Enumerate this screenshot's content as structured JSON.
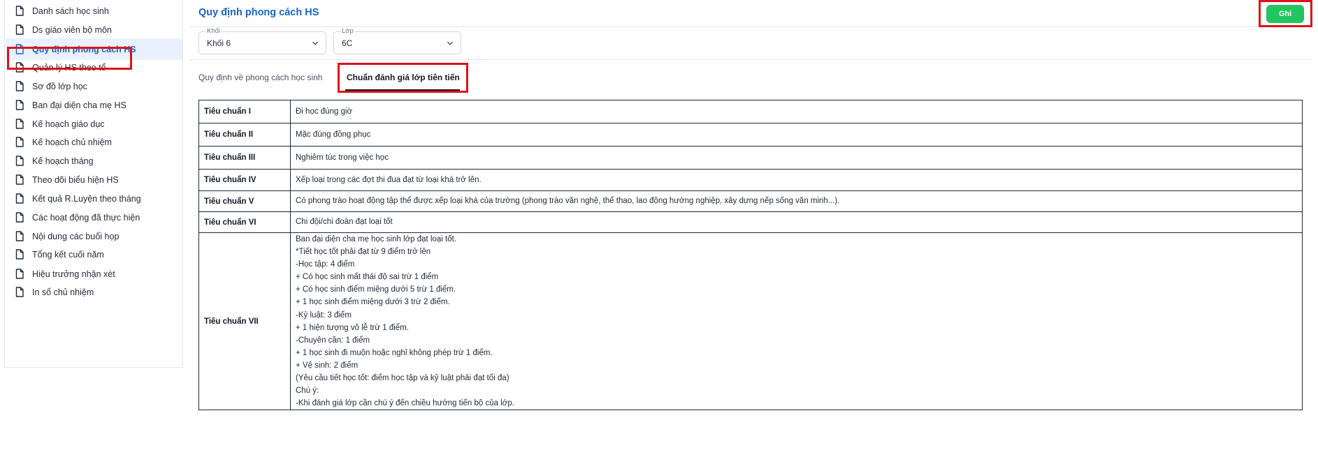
{
  "sidebar": {
    "items": [
      {
        "label": "Danh sách học sinh",
        "active": false
      },
      {
        "label": "Ds giáo viên bộ môn",
        "active": false
      },
      {
        "label": "Quy định phong cách HS",
        "active": true
      },
      {
        "label": "Quản lý HS theo tổ",
        "active": false
      },
      {
        "label": "Sơ đồ lớp học",
        "active": false
      },
      {
        "label": "Ban đại diện cha mẹ HS",
        "active": false
      },
      {
        "label": "Kế hoạch giáo dục",
        "active": false
      },
      {
        "label": "Kế hoạch chủ nhiệm",
        "active": false
      },
      {
        "label": "Kế hoạch tháng",
        "active": false
      },
      {
        "label": "Theo dõi biểu hiện HS",
        "active": false
      },
      {
        "label": "Kết quả R.Luyện theo tháng",
        "active": false
      },
      {
        "label": "Các hoạt động đã thực hiện",
        "active": false
      },
      {
        "label": "Nội dung các buổi họp",
        "active": false
      },
      {
        "label": "Tổng kết cuối năm",
        "active": false
      },
      {
        "label": "Hiệu trưởng nhận xét",
        "active": false
      },
      {
        "label": "In sổ chủ nhiệm",
        "active": false
      }
    ]
  },
  "header": {
    "title": "Quy định phong cách HS",
    "save_label": "Ghi"
  },
  "filters": {
    "grade": {
      "legend": "Khối",
      "value": "Khối 6"
    },
    "class": {
      "legend": "Lớp",
      "value": "6C"
    }
  },
  "tabs": [
    {
      "label": "Quy định về phong cách học sinh",
      "active": false
    },
    {
      "label": "Chuẩn đánh giá lớp tiên tiến",
      "active": true
    }
  ],
  "criteria": [
    {
      "name": "Tiêu chuẩn I",
      "lines": [
        "Đi học đúng giờ"
      ]
    },
    {
      "name": "Tiêu chuẩn II",
      "lines": [
        "Mặc đúng đồng phục"
      ]
    },
    {
      "name": "Tiêu chuẩn III",
      "lines": [
        "Nghiêm túc trong việc học"
      ]
    },
    {
      "name": "Tiêu chuẩn IV",
      "lines": [
        "Xếp loại trong các đợt thi đua đạt từ loại khá trở lên."
      ]
    },
    {
      "name": "Tiêu chuẩn V",
      "lines": [
        "Có phong trào hoạt động tập thể được xếp loại khá của trường (phong trào văn nghệ, thể thao, lao động hướng nghiệp, xây dựng nếp sống văn minh...)."
      ]
    },
    {
      "name": "Tiêu chuẩn VI",
      "lines": [
        "Chi đội/chi đoàn đạt loại tốt"
      ]
    },
    {
      "name": "Tiêu chuẩn VII",
      "lines": [
        "Ban đại diện cha mẹ học sinh lớp đạt loại tốt.",
        "*Tiết học tốt phải đạt từ 9 điểm trở lên",
        "-Học tập: 4 điểm",
        "+ Có học sinh mất thái độ sai trừ 1 điểm",
        "+ Có học sinh điểm miệng dưới 5 trừ 1 điểm.",
        "+ 1 học sinh điểm miệng dưới 3 trừ 2 điểm.",
        "-Kỷ luật: 3 điểm",
        "+ 1 hiện tượng vô lễ trừ 1 điểm.",
        "-Chuyên cần: 1 điểm",
        "+ 1 học sinh đi muộn hoặc nghỉ không phép trừ 1 điểm.",
        "+ Vệ sinh: 2 điểm",
        "(Yêu cầu tiết học tốt: điểm học tập và kỷ luật phải đạt tối đa)",
        "Chú ý:",
        "-Khi đánh giá lớp cần chú ý đến chiều hướng tiến bộ của lớp."
      ]
    }
  ],
  "colors": {
    "accent": "#1a63c7",
    "save": "#22c55e",
    "highlight": "#e0101b",
    "active_bg": "#e8f1fd"
  }
}
